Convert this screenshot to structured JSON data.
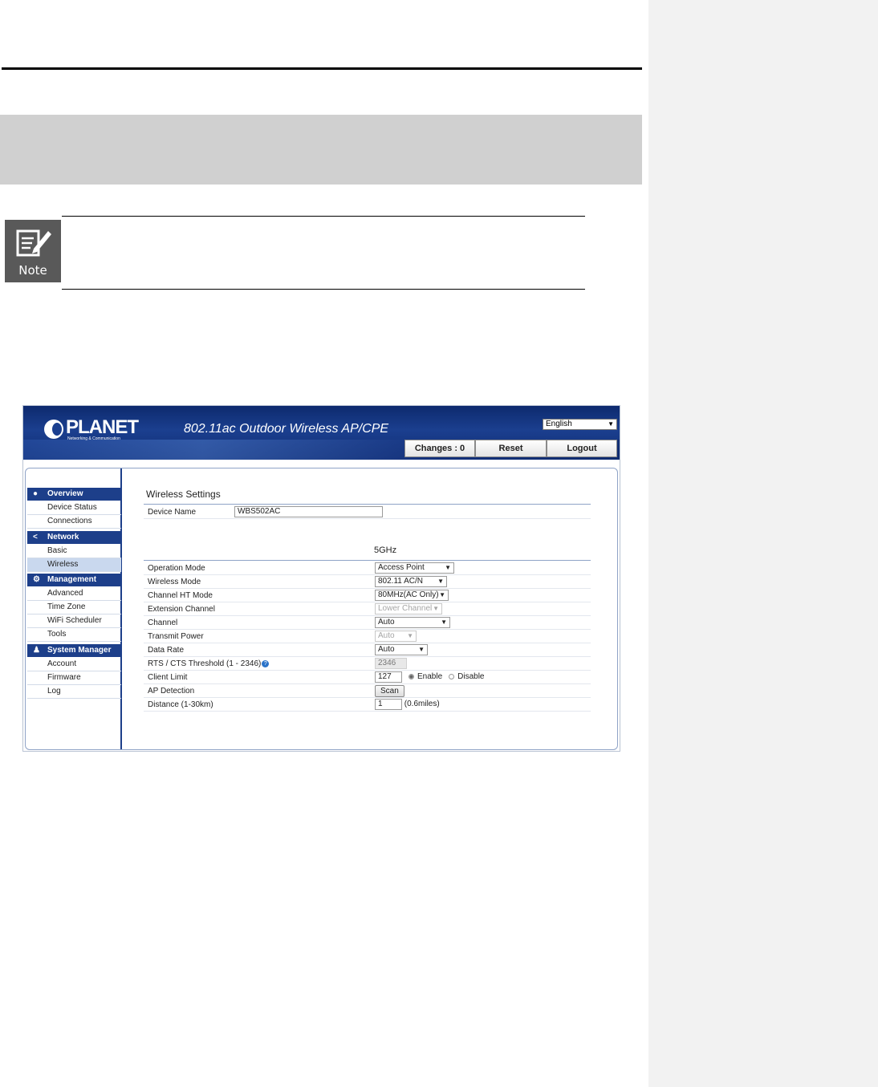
{
  "note": {
    "label": "Note"
  },
  "header": {
    "logo_word": "PLANET",
    "logo_tagline": "Networking & Communication",
    "title": "802.11ac Outdoor Wireless AP/CPE",
    "language": "English",
    "changes_label": "Changes : 0",
    "reset_label": "Reset",
    "logout_label": "Logout"
  },
  "sidebar": {
    "overview": {
      "label": "Overview",
      "items": [
        "Device Status",
        "Connections"
      ]
    },
    "network": {
      "label": "Network",
      "items": [
        "Basic",
        "Wireless"
      ]
    },
    "management": {
      "label": "Management",
      "items": [
        "Advanced",
        "Time Zone",
        "WiFi Scheduler",
        "Tools"
      ]
    },
    "system_manager": {
      "label": "System Manager",
      "items": [
        "Account",
        "Firmware",
        "Log"
      ]
    },
    "active_item": "Wireless"
  },
  "main": {
    "title": "Wireless Settings",
    "device_name_label": "Device Name",
    "device_name_value": "WBS502AC",
    "band": "5GHz",
    "operation_mode": {
      "label": "Operation Mode",
      "value": "Access Point"
    },
    "wireless_mode": {
      "label": "Wireless Mode",
      "value": "802.11 AC/N"
    },
    "channel_ht_mode": {
      "label": "Channel HT Mode",
      "value": "80MHz(AC Only)"
    },
    "extension_channel": {
      "label": "Extension Channel",
      "value": "Lower Channel"
    },
    "channel": {
      "label": "Channel",
      "value": "Auto"
    },
    "transmit_power": {
      "label": "Transmit Power",
      "value": "Auto"
    },
    "data_rate": {
      "label": "Data Rate",
      "value": "Auto"
    },
    "rts_cts": {
      "label": "RTS / CTS Threshold (1 - 2346)",
      "value": "2346"
    },
    "client_limit": {
      "label": "Client Limit",
      "value": "127",
      "enable_label": "Enable",
      "disable_label": "Disable"
    },
    "ap_detection": {
      "label": "AP Detection",
      "button": "Scan"
    },
    "distance": {
      "label": "Distance (1-30km)",
      "value": "1",
      "unit": "(0.6miles)"
    }
  }
}
